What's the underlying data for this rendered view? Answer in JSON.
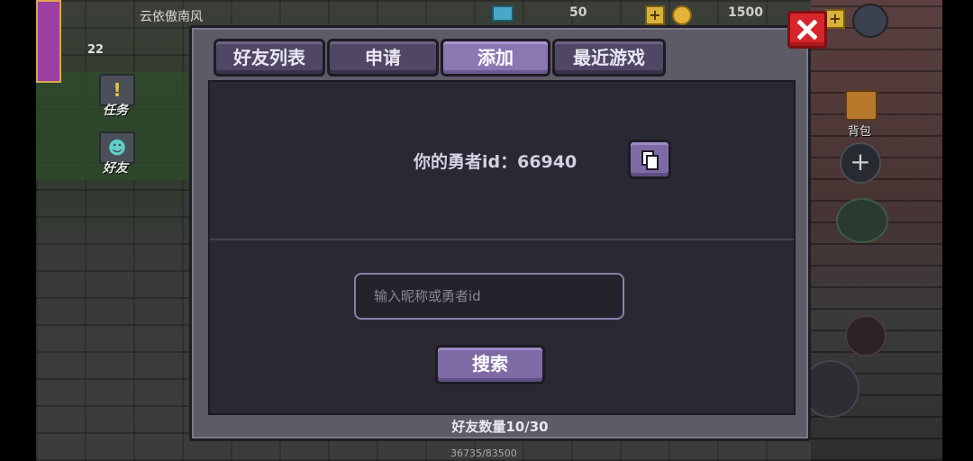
{
  "hud": {
    "player_name": "云依傲南风",
    "player_level": "22",
    "side_buttons": [
      {
        "label": "任务",
        "icon": "exclamation-icon"
      },
      {
        "label": "好友",
        "icon": "friend-icon"
      }
    ],
    "currency_value": "50",
    "gems_value": "1500",
    "bag_label": "背包",
    "hp_readout": "36735/83500"
  },
  "dialog": {
    "tabs": [
      {
        "label": "好友列表",
        "active": false
      },
      {
        "label": "申请",
        "active": false
      },
      {
        "label": "添加",
        "active": true
      },
      {
        "label": "最近游戏",
        "active": false
      }
    ],
    "hero_id_label": "你的勇者id：66940",
    "search": {
      "placeholder": "输入昵称或勇者id",
      "value": "",
      "button_label": "搜索"
    },
    "friend_count": "好友数量10/30"
  },
  "colors": {
    "accent_purple": "#7e6ba6",
    "panel_dark": "#2a2830",
    "dialog_frame": "#5d5b66",
    "close_red": "#d7262b"
  }
}
